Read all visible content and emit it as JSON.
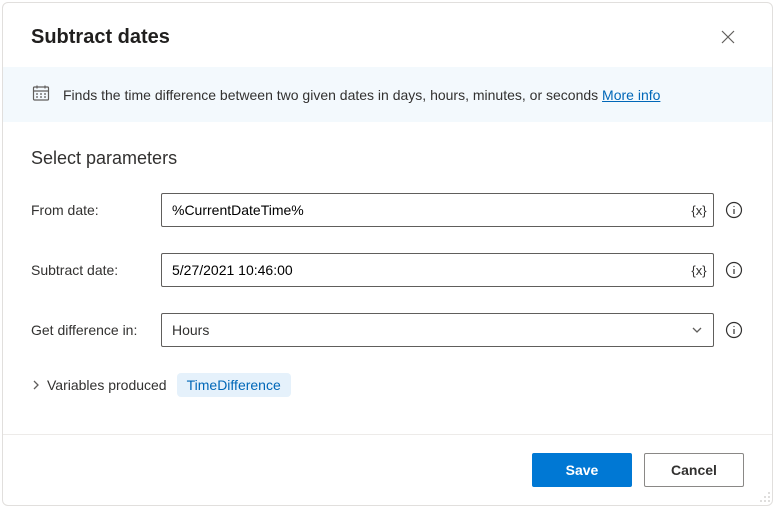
{
  "dialog": {
    "title": "Subtract dates",
    "description": "Finds the time difference between two given dates in days, hours, minutes, or seconds",
    "more_info": "More info"
  },
  "section": {
    "title": "Select parameters"
  },
  "fields": {
    "from_date": {
      "label": "From date:",
      "value": "%CurrentDateTime%"
    },
    "subtract_date": {
      "label": "Subtract date:",
      "value": "5/27/2021 10:46:00"
    },
    "get_difference": {
      "label": "Get difference in:",
      "value": "Hours"
    }
  },
  "variables": {
    "label": "Variables produced",
    "chip": "TimeDifference"
  },
  "footer": {
    "save": "Save",
    "cancel": "Cancel"
  },
  "glyphs": {
    "var_token": "{x}"
  }
}
